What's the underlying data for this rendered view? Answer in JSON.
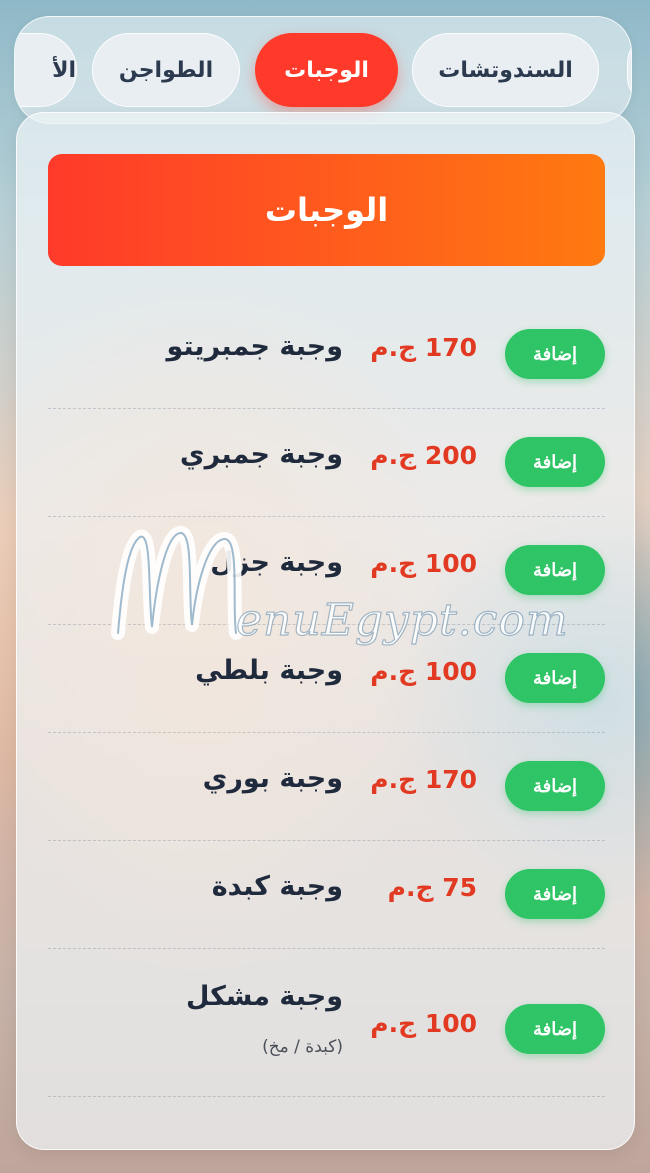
{
  "tabs": {
    "partial_left": "الأ",
    "tagines": "الطواجن",
    "meals": "الوجبات",
    "sandwiches": "السندوتشات"
  },
  "section": {
    "title": "الوجبات"
  },
  "add_label": "إضافة",
  "items": [
    {
      "name": "وجبة جمبريتو",
      "price": "170 ج.م"
    },
    {
      "name": "وجبة جمبري",
      "price": "200 ج.م"
    },
    {
      "name": "وجبة جزل",
      "price": "100 ج.م"
    },
    {
      "name": "وجبة بلطي",
      "price": "100 ج.م"
    },
    {
      "name": "وجبة بوري",
      "price": "170 ج.م"
    },
    {
      "name": "وجبة كبدة",
      "price": "75 ج.م"
    },
    {
      "name": "وجبة مشكل",
      "price": "100 ج.م",
      "note": "(كبدة / مخ)"
    }
  ],
  "watermark": {
    "text": "enuEgypt.com"
  },
  "colors": {
    "accent": "#ff3a2a",
    "gradient_end": "#ff7a10",
    "price": "#e23a22",
    "add_button": "#2fc466",
    "text_dark": "#1f2a3d"
  }
}
